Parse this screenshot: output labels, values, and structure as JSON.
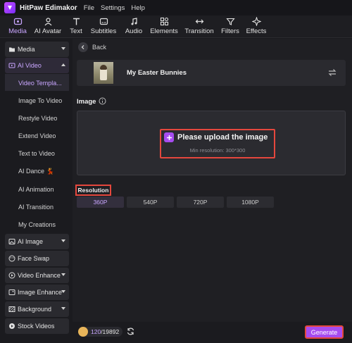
{
  "app": {
    "title": "HitPaw Edimakor",
    "menu": [
      "File",
      "Settings",
      "Help"
    ]
  },
  "toolbar": {
    "items": [
      {
        "label": "Media",
        "icon": "media-icon",
        "active": true
      },
      {
        "label": "AI Avatar",
        "icon": "avatar-icon"
      },
      {
        "label": "Text",
        "icon": "text-icon"
      },
      {
        "label": "Subtitles",
        "icon": "subtitles-icon"
      },
      {
        "label": "Audio",
        "icon": "audio-icon"
      },
      {
        "label": "Elements",
        "icon": "elements-icon"
      },
      {
        "label": "Transition",
        "icon": "transition-icon"
      },
      {
        "label": "Filters",
        "icon": "filters-icon"
      },
      {
        "label": "Effects",
        "icon": "effects-icon"
      }
    ]
  },
  "sidebar": {
    "media": "Media",
    "ai_video": "AI Video",
    "ai_video_items": [
      "Video Templa...",
      "Image To Video",
      "Restyle Video",
      "Extend Video",
      "Text to Video",
      "AI Dance 💃",
      "AI Animation",
      "AI Transition",
      "My Creations"
    ],
    "ai_image": "AI Image",
    "face_swap": "Face Swap",
    "video_enhance": "Video Enhance",
    "image_enhance": "Image Enhance",
    "background": "Background",
    "stock_videos": "Stock Videos"
  },
  "main": {
    "back_label": "Back",
    "template_name": "My Easter Bunnies",
    "image_section_label": "Image",
    "upload_title": "Please upload the image",
    "upload_hint": "Min resolution: 300*300",
    "resolution_label": "Resolution",
    "resolutions": [
      "360P",
      "540P",
      "720P",
      "1080P"
    ],
    "selected_resolution": "360P",
    "credits_used": "120",
    "credits_total": "/19892",
    "generate_label": "Generate"
  },
  "colors": {
    "accent": "#a64cf0",
    "accent_text": "#c9a6ff",
    "highlight_border": "#e5473d",
    "background": "#1b1b1f"
  }
}
